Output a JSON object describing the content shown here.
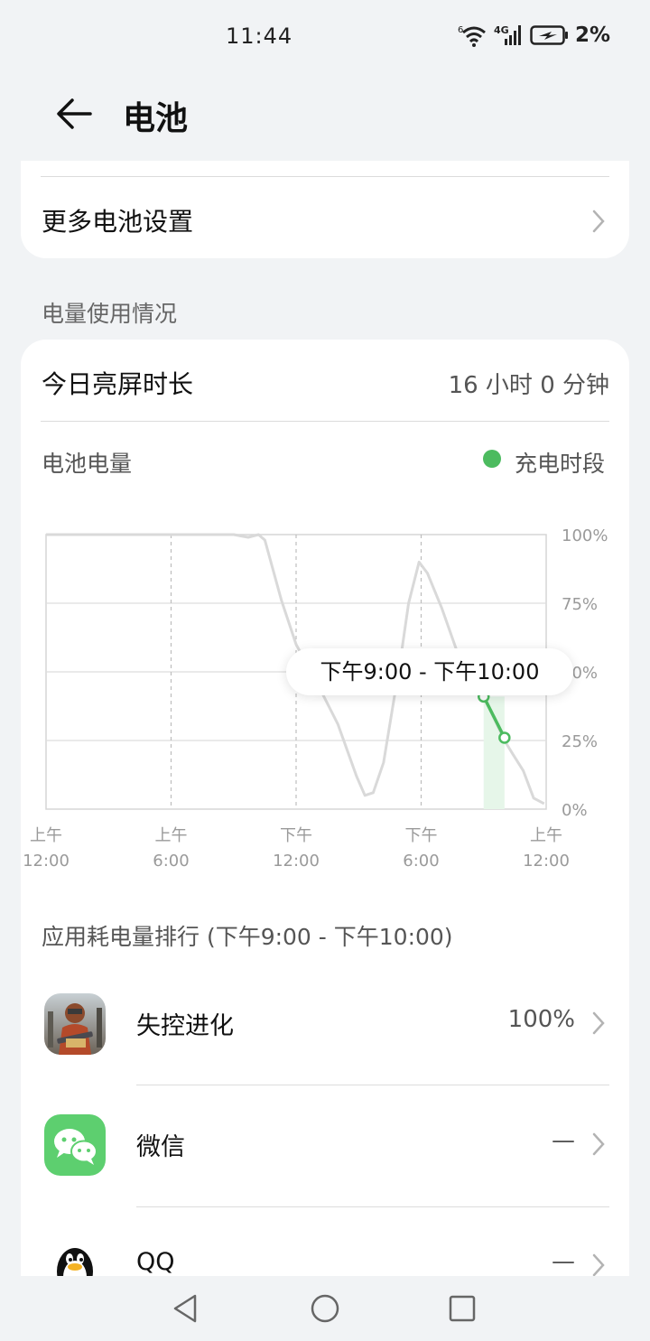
{
  "status_bar": {
    "time": "11:44",
    "wifi_tag": "6",
    "network": "4G",
    "battery_percent": "2%",
    "icons": [
      "wifi-icon",
      "signal-icon",
      "battery-charging-icon"
    ]
  },
  "header": {
    "title": "电池",
    "back_icon": "arrow-left-icon"
  },
  "top_card": {
    "more_settings_label": "更多电池设置"
  },
  "usage_section": {
    "title": "电量使用情况",
    "screen_time_label": "今日亮屏时长",
    "screen_time_value": "16 小时 0 分钟",
    "battery_level_label": "电池电量",
    "legend_label": "充电时段",
    "legend_color": "#4cbb5f",
    "tooltip": "下午9:00 - 下午10:00"
  },
  "chart_data": {
    "type": "line",
    "title": "电池电量",
    "y_tick_labels": [
      "100%",
      "75%",
      "50%",
      "25%",
      "0%"
    ],
    "ylim": [
      0,
      100
    ],
    "x_tick_labels": [
      {
        "period": "上午",
        "time": "12:00"
      },
      {
        "period": "上午",
        "time": "6:00"
      },
      {
        "period": "下午",
        "time": "12:00"
      },
      {
        "period": "下午",
        "time": "6:00"
      },
      {
        "period": "上午",
        "time": "12:00"
      }
    ],
    "x_range_hours": [
      0,
      24
    ],
    "series": [
      {
        "name": "电池电量",
        "color": "#d9d9d9",
        "points": [
          [
            0,
            100
          ],
          [
            9,
            100
          ],
          [
            9.7,
            99
          ],
          [
            10.2,
            100
          ],
          [
            10.5,
            98
          ],
          [
            11.3,
            76
          ],
          [
            12,
            60
          ],
          [
            13,
            46
          ],
          [
            14,
            31
          ],
          [
            14.9,
            12
          ],
          [
            15.3,
            5
          ],
          [
            15.7,
            6
          ],
          [
            16.2,
            17
          ],
          [
            17,
            54
          ],
          [
            17.4,
            75
          ],
          [
            17.9,
            90
          ],
          [
            18.3,
            86
          ],
          [
            19,
            73
          ],
          [
            19.7,
            58
          ],
          [
            20.3,
            48
          ],
          [
            21,
            41
          ],
          [
            22,
            25
          ],
          [
            22.4,
            20
          ],
          [
            22.9,
            14
          ],
          [
            23.4,
            4
          ],
          [
            23.9,
            2
          ]
        ]
      }
    ],
    "highlight": {
      "color": "#4cbb5f",
      "x_start": 21,
      "x_end": 22,
      "points": [
        [
          21,
          41
        ],
        [
          22,
          26
        ]
      ]
    }
  },
  "ranking": {
    "title": "应用耗电量排行 (下午9:00 - 下午10:00)",
    "apps": [
      {
        "name": "失控进化",
        "value": "100%",
        "icon": "game-icon"
      },
      {
        "name": "微信",
        "value": "—",
        "icon": "wechat-icon"
      },
      {
        "name": "QQ",
        "value": "—",
        "icon": "qq-penguin-icon"
      }
    ]
  },
  "nav_bar": {
    "icons": [
      "back-triangle-icon",
      "home-circle-icon",
      "recents-square-icon"
    ]
  }
}
